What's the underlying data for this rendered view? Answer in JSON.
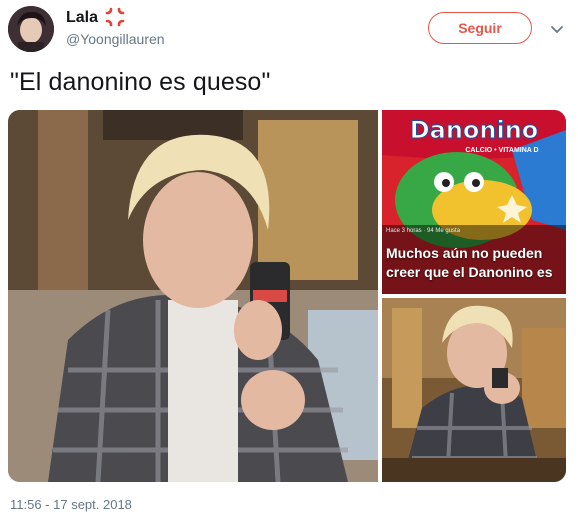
{
  "user": {
    "display_name": "Lala",
    "emoji_icon": "anger-symbol-icon",
    "handle": "@Yoongillauren"
  },
  "follow_button": {
    "label": "Seguir",
    "color": "#e8564a"
  },
  "tweet": {
    "text": "\"El danonino es queso\"",
    "timestamp": "11:56 - 17 sept. 2018"
  },
  "media": {
    "ad_brand": "Danonino",
    "ad_tagline": "CALCIO • VITAMINA D",
    "ad_meta": "Hace 3 horas · 94 Me gusta",
    "ad_caption": "Muchos aún no pueden creer que el Danonino es"
  },
  "colors": {
    "text": "#14171a",
    "muted": "#657786",
    "accent": "#e8564a",
    "background": "#ffffff"
  }
}
